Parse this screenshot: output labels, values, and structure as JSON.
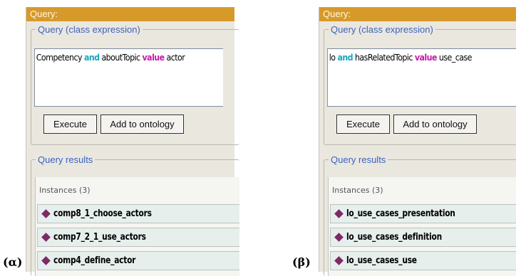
{
  "panels": [
    {
      "caption": "(α)",
      "header_title": "Query:",
      "query_legend": "Query (class expression)",
      "query_tokens": [
        {
          "text": "Competency ",
          "kind": "normal"
        },
        {
          "text": "and",
          "kind": "and"
        },
        {
          "text": " aboutTopic ",
          "kind": "normal"
        },
        {
          "text": "value",
          "kind": "value"
        },
        {
          "text": " actor",
          "kind": "normal"
        }
      ],
      "execute_label": "Execute",
      "add_label": "Add to ontology",
      "results_legend": "Query results",
      "instances_label": "Instances (3)",
      "results": [
        "comp8_1_choose_actors",
        "comp7_2_1_use_actors",
        "comp4_define_actor"
      ]
    },
    {
      "caption": "(β)",
      "header_title": "Query:",
      "query_legend": "Query (class expression)",
      "query_tokens": [
        {
          "text": "lo ",
          "kind": "normal"
        },
        {
          "text": "and",
          "kind": "and"
        },
        {
          "text": " hasRelatedTopic ",
          "kind": "normal"
        },
        {
          "text": "value",
          "kind": "value"
        },
        {
          "text": " use_case",
          "kind": "normal"
        }
      ],
      "execute_label": "Execute",
      "add_label": "Add to ontology",
      "results_legend": "Query results",
      "instances_label": "Instances (3)",
      "results": [
        "lo_use_cases_presentation",
        "lo_use_cases_definition",
        "lo_use_cases_use"
      ]
    }
  ],
  "colors": {
    "header": "#d69a2b",
    "legend": "#3a63c0",
    "keyword_and": "#19a6c0",
    "keyword_value": "#c21ba8",
    "instance_diamond": "#7d2a66"
  },
  "icons": {
    "instance": "individual-diamond-icon"
  }
}
